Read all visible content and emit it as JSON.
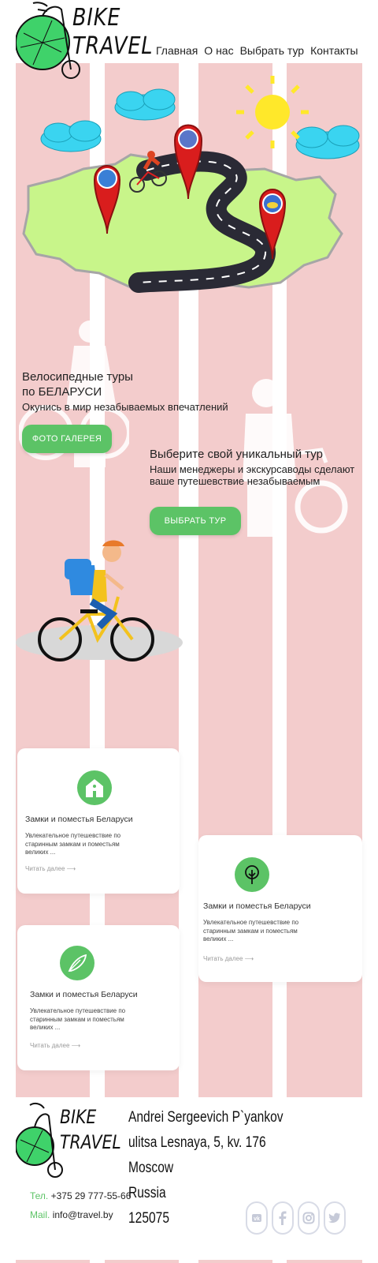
{
  "brand": {
    "line1": "BIKE",
    "line2": "TRAVEL"
  },
  "nav": {
    "items": [
      "Главная",
      "О нас",
      "Выбрать тур",
      "Контакты"
    ]
  },
  "hero": {
    "title_line1": "Велосипедные туры",
    "title_line2": "по БЕЛАРУСИ",
    "subtitle": "Окунись в мир незабываемых впечатлений",
    "gallery_button": "ФОТО ГАЛЕРЕЯ"
  },
  "tour": {
    "title": "Выберите свой уникальный тур",
    "subtitle": "Наши менеджеры и экскурсаводы сделают ваше путешевствие незабываемым",
    "button": "ВЫБРАТЬ ТУР"
  },
  "cards": [
    {
      "icon": "house-icon",
      "title": "Замки и поместья Беларуси",
      "text": "Увлекательное путешевствие по старинным замкам и поместьям великих ...",
      "link": "Читать далее ⟶"
    },
    {
      "icon": "tree-icon",
      "title": "Замки и поместья Беларуси",
      "text": "Увлекательное путешевствие по старинным замкам и поместьям великих ...",
      "link": "Читать далее ⟶"
    },
    {
      "icon": "feather-icon",
      "title": "Замки и поместья Беларуси",
      "text": "Увлекательное путешевствие по старинным замкам и поместьям великих ...",
      "link": "Читать далее ⟶"
    }
  ],
  "footer": {
    "phone_label": "Тел.",
    "phone": "+375 29 777-55-66",
    "mail_label": "Mail.",
    "mail": "info@travel.by",
    "address": [
      "Andrei Sergeevich P`yankov",
      "ulitsa Lesnaya, 5, kv. 176",
      "Moscow",
      "Russia",
      "125075"
    ],
    "social": [
      "vk-icon",
      "facebook-icon",
      "instagram-icon",
      "twitter-icon"
    ]
  },
  "colors": {
    "accent": "#5cc366",
    "stripe": "#f3cccc",
    "map": "#c8f58a",
    "pin": "#d91d1d",
    "cloud": "#3ad4f0"
  }
}
